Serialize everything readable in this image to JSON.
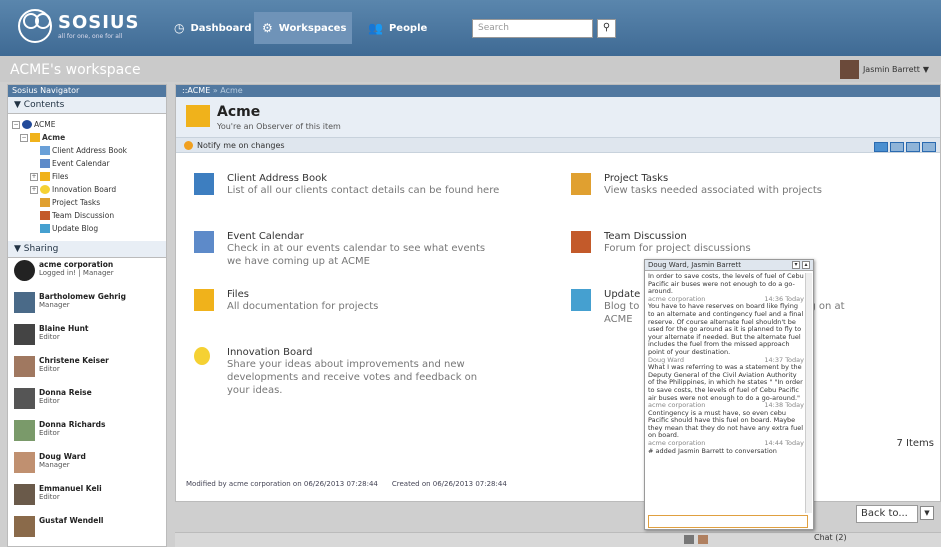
{
  "brand": {
    "name": "SOSIUS",
    "tagline": "all for one, one for all"
  },
  "nav": [
    {
      "label": "Dashboard",
      "icon": "clock-icon"
    },
    {
      "label": "Workspaces",
      "icon": "gears-icon"
    },
    {
      "label": "People",
      "icon": "people-icon"
    }
  ],
  "search": {
    "placeholder": "Search"
  },
  "workspace": {
    "title": "ACME's workspace"
  },
  "user": {
    "name": "Jasmin Barrett"
  },
  "sidebar": {
    "header": "Sosius Navigator",
    "contents_label": "Contents",
    "tree": [
      {
        "label": "ACME",
        "level": 0
      },
      {
        "label": "Acme",
        "level": 1
      },
      {
        "label": "Client Address Book",
        "level": 2
      },
      {
        "label": "Event Calendar",
        "level": 2
      },
      {
        "label": "Files",
        "level": 2
      },
      {
        "label": "Innovation Board",
        "level": 2
      },
      {
        "label": "Project Tasks",
        "level": 2
      },
      {
        "label": "Team Discussion",
        "level": 2
      },
      {
        "label": "Update Blog",
        "level": 2
      }
    ],
    "sharing_label": "Sharing",
    "members": [
      {
        "name": "acme corporation",
        "role": "Logged in! | Manager"
      },
      {
        "name": "Bartholomew Gehrig",
        "role": "Manager"
      },
      {
        "name": "Blaine Hunt",
        "role": "Editor"
      },
      {
        "name": "Christene Keiser",
        "role": "Editor"
      },
      {
        "name": "Donna Reise",
        "role": "Editor"
      },
      {
        "name": "Donna Richards",
        "role": "Editor"
      },
      {
        "name": "Doug Ward",
        "role": "Manager"
      },
      {
        "name": "Emmanuel Keli",
        "role": "Editor"
      },
      {
        "name": "Gustaf Wendell",
        "role": ""
      }
    ]
  },
  "breadcrumb": {
    "root": "::ACME",
    "sep": "»",
    "current": "Acme"
  },
  "header": {
    "title": "Acme",
    "subtitle": "You're an Observer of this item"
  },
  "notify": {
    "label": "Notify me on changes"
  },
  "items": [
    {
      "title": "Client Address Book",
      "desc": "List of all our clients contact details can be found here",
      "icon": "address-book-icon"
    },
    {
      "title": "Project Tasks",
      "desc": "View tasks needed associated with projects",
      "icon": "briefcase-icon"
    },
    {
      "title": "Event Calendar",
      "desc": "Check in at our events calendar to see what events we have coming up at ACME",
      "icon": "calendar-icon"
    },
    {
      "title": "Team Discussion",
      "desc": "Forum for project discussions",
      "icon": "discussion-icon"
    },
    {
      "title": "Files",
      "desc": "All documentation for projects",
      "icon": "folder-icon"
    },
    {
      "title": "Update",
      "desc": "Blog to",
      "desc_tail": "g on at",
      "desc2": "ACME",
      "icon": "blog-icon"
    },
    {
      "title": "Innovation Board",
      "desc": "Share your ideas about improvements and new developments and receive votes and feedback on your ideas.",
      "icon": "lightbulb-icon"
    }
  ],
  "footer": {
    "modified": "Modified by acme corporation on 06/26/2013 07:28:44",
    "created": "Created on 06/26/2013 07:28:44"
  },
  "count": "7 Items",
  "back": {
    "label": "Back to..."
  },
  "chat": {
    "title": "Doug Ward, Jasmin Barrett",
    "messages": [
      {
        "text": "In order to save costs, the levels of fuel of Cebu Pacific air buses were not enough to do a go-around."
      },
      {
        "author": "acme corporation",
        "time": "14:36 Today",
        "text": "You have to have reserves on board like flying to an alternate and contingency fuel and a final reserve. Of course alternate fuel shouldn't be used for the go around as it is planned to fly to your alternate if needed. But the alternate fuel includes the fuel from the missed approach point of your destination."
      },
      {
        "author": "Doug Ward",
        "time": "14:37 Today",
        "text": "What I was referring to was a statement by the Deputy General of the Civil Aviation Authority of the Philippines, in which he states \" \"In order to save costs, the levels of fuel of Cebu Pacific air buses were not enough to do a go-around.\""
      },
      {
        "author": "acme corporation",
        "time": "14:38 Today",
        "text": "Contingency is a must have, so even cebu Pacific should have this fuel on board. Maybe they mean that they do not have any extra fuel on board."
      },
      {
        "author": "acme corporation",
        "time": "14:44 Today",
        "text": "# added Jasmin Barrett to conversation"
      }
    ],
    "tab_label": "Chat (2)"
  }
}
